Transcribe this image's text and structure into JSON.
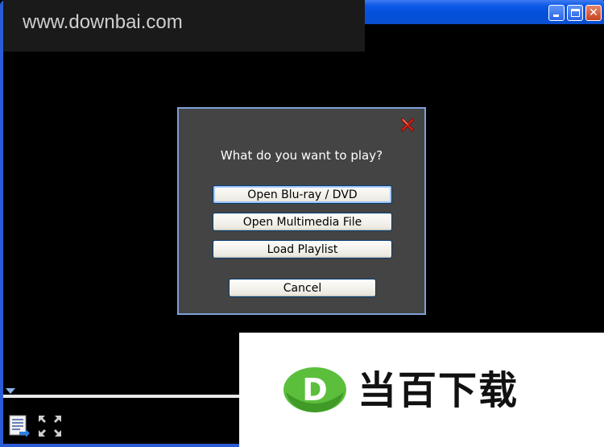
{
  "watermark": {
    "text": "www.downbai.com"
  },
  "dialog": {
    "title": "What do you want to play?",
    "buttons": {
      "bluray": "Open Blu-ray / DVD",
      "multimedia": "Open Multimedia File",
      "playlist": "Load Playlist",
      "cancel": "Cancel"
    }
  },
  "logo": {
    "text": "当百下载",
    "letter": "D"
  },
  "colors": {
    "titlebar": "#0a58e6",
    "dialog_bg": "#444444",
    "dialog_border": "#7e9fd8",
    "logo_green": "#5bbf3c"
  },
  "icons": {
    "minimize": "minimize-icon",
    "maximize": "maximize-icon",
    "close": "close-icon",
    "dialog_close": "red-x-icon",
    "playlist": "playlist-icon",
    "fullscreen": "fullscreen-icon",
    "seek_marker": "seek-marker-icon"
  }
}
